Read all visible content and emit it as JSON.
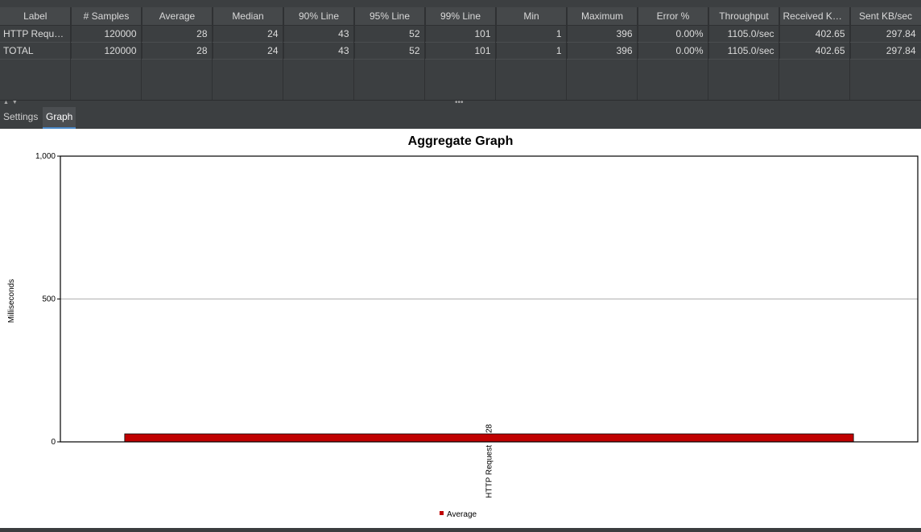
{
  "table": {
    "columns": [
      "Label",
      "# Samples",
      "Average",
      "Median",
      "90% Line",
      "95% Line",
      "99% Line",
      "Min",
      "Maximum",
      "Error %",
      "Throughput",
      "Received KB...",
      "Sent KB/sec"
    ],
    "rows": [
      [
        "HTTP Reque...",
        "120000",
        "28",
        "24",
        "43",
        "52",
        "101",
        "1",
        "396",
        "0.00%",
        "1105.0/sec",
        "402.65",
        "297.84"
      ],
      [
        "TOTAL",
        "120000",
        "28",
        "24",
        "43",
        "52",
        "101",
        "1",
        "396",
        "0.00%",
        "1105.0/sec",
        "402.65",
        "297.84"
      ]
    ]
  },
  "tabs": [
    {
      "label": "Settings",
      "active": false
    },
    {
      "label": "Graph",
      "active": true
    }
  ],
  "chart_data": {
    "type": "bar",
    "title": "Aggregate Graph",
    "ylabel": "Milliseconds",
    "ylim": [
      0,
      1000
    ],
    "yticks": [
      "1,000",
      "500",
      "0"
    ],
    "categories": [
      "HTTP Request"
    ],
    "series": [
      {
        "name": "Average",
        "values": [
          28
        ],
        "color": "#c00000"
      }
    ],
    "data_labels": [
      "28"
    ],
    "legend": "bottom-center",
    "grid": true
  }
}
